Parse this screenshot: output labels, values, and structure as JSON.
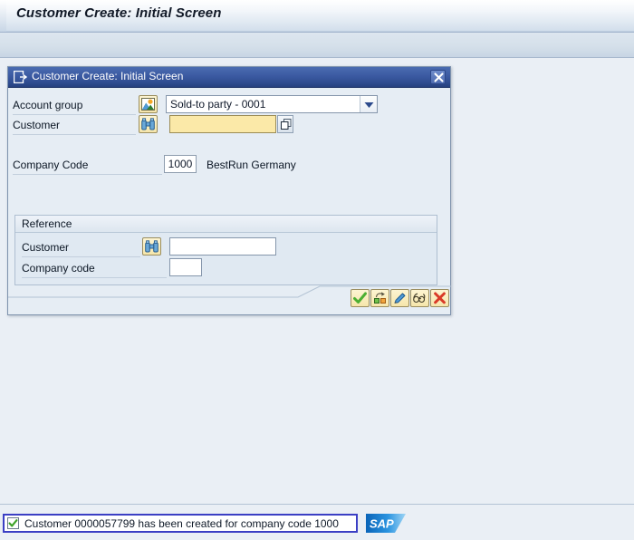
{
  "app": {
    "title": "Customer Create: Initial Screen"
  },
  "dialog": {
    "title": "Customer Create: Initial Screen",
    "title_icon": "dialog-window-icon",
    "close_icon": "close-icon",
    "fields": {
      "account_group": {
        "label": "Account group",
        "icon": "picture-mountain-icon",
        "value": "Sold-to party - 0001",
        "dropdown_icon": "chevron-down-icon"
      },
      "customer": {
        "label": "Customer",
        "icon": "binoculars-icon",
        "value": "",
        "value_help_icon": "value-help-icon",
        "focused": "true"
      },
      "company_code": {
        "label": "Company Code",
        "value": "1000",
        "description": "BestRun Germany"
      }
    },
    "reference_group": {
      "title": "Reference",
      "customer": {
        "label": "Customer",
        "icon": "binoculars-icon",
        "value": ""
      },
      "company_code": {
        "label": "Company code",
        "value": ""
      }
    },
    "buttons": [
      {
        "name": "continue-button",
        "icon": "green-check-icon",
        "label": "Continue"
      },
      {
        "name": "customer-template-button",
        "icon": "shapes-copy-icon",
        "label": "Customer"
      },
      {
        "name": "change-button",
        "icon": "pencil-icon",
        "label": "Change"
      },
      {
        "name": "display-button",
        "icon": "glasses-icon",
        "label": "Display"
      },
      {
        "name": "cancel-button",
        "icon": "red-x-icon",
        "label": "Cancel"
      }
    ]
  },
  "statusbar": {
    "icon": "success-check-icon",
    "message": "Customer 0000057799 has been created for company code 1000",
    "logo": "SAP"
  },
  "colors": {
    "titlebar_blue": "#3c5ba3",
    "field_yellow": "#fbe9a8",
    "focus_red": "#d81d1d",
    "status_border": "#3b3fc4",
    "success_green": "#4caf32",
    "sap_blue": "#1d7fd6"
  }
}
